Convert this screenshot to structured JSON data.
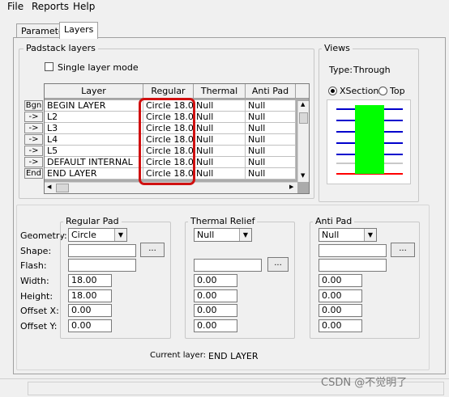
{
  "menu": {
    "items": [
      "File",
      "Reports",
      "Help"
    ]
  },
  "tabs": {
    "parameters": "Parameters",
    "layers": "Layers"
  },
  "padstack": {
    "title": "Padstack layers",
    "single_layer_mode": "Single layer mode",
    "single_layer_checked": false,
    "columns": {
      "layer": "Layer",
      "regular": "Regular Pad",
      "thermal": "Thermal Relief",
      "anti": "Anti Pad"
    },
    "rows": [
      {
        "button": "Bgn",
        "layer": "BEGIN LAYER",
        "regular": "Circle 18.00",
        "thermal": "Null",
        "anti": "Null"
      },
      {
        "button": "->",
        "layer": "L2",
        "regular": "Circle 18.00",
        "thermal": "Null",
        "anti": "Null"
      },
      {
        "button": "->",
        "layer": "L3",
        "regular": "Circle 18.00",
        "thermal": "Null",
        "anti": "Null"
      },
      {
        "button": "->",
        "layer": "L4",
        "regular": "Circle 18.00",
        "thermal": "Null",
        "anti": "Null"
      },
      {
        "button": "->",
        "layer": "L5",
        "regular": "Circle 18.00",
        "thermal": "Null",
        "anti": "Null"
      },
      {
        "button": "->",
        "layer": "DEFAULT INTERNAL",
        "regular": "Circle 18.00",
        "thermal": "Null",
        "anti": "Null"
      },
      {
        "button": "End",
        "layer": "END LAYER",
        "regular": "Circle 18.00",
        "thermal": "Null",
        "anti": "Null"
      }
    ]
  },
  "views": {
    "title": "Views",
    "type_label": "Type:",
    "type_value": "Through",
    "xsection_label": "XSection",
    "top_label": "Top",
    "selected": "XSection",
    "colors": {
      "layer": "#0000cc",
      "end": "#ff0000",
      "via": "#00ff00"
    }
  },
  "form": {
    "labels": {
      "geometry": "Geometry:",
      "shape": "Shape:",
      "flash": "Flash:",
      "width": "Width:",
      "height": "Height:",
      "offset_x": "Offset X:",
      "offset_y": "Offset Y:"
    },
    "browse": "...",
    "regular": {
      "title": "Regular Pad",
      "geometry": "Circle",
      "width": "18.00",
      "height": "18.00",
      "offset_x": "0.00",
      "offset_y": "0.00"
    },
    "thermal": {
      "title": "Thermal Relief",
      "geometry": "Null",
      "width": "0.00",
      "height": "0.00",
      "offset_x": "0.00",
      "offset_y": "0.00"
    },
    "anti": {
      "title": "Anti Pad",
      "geometry": "Null",
      "width": "0.00",
      "height": "0.00",
      "offset_x": "0.00",
      "offset_y": "0.00"
    },
    "current_layer_label": "Current layer:",
    "current_layer_value": "END LAYER"
  },
  "watermark": "CSDN @不觉明了"
}
